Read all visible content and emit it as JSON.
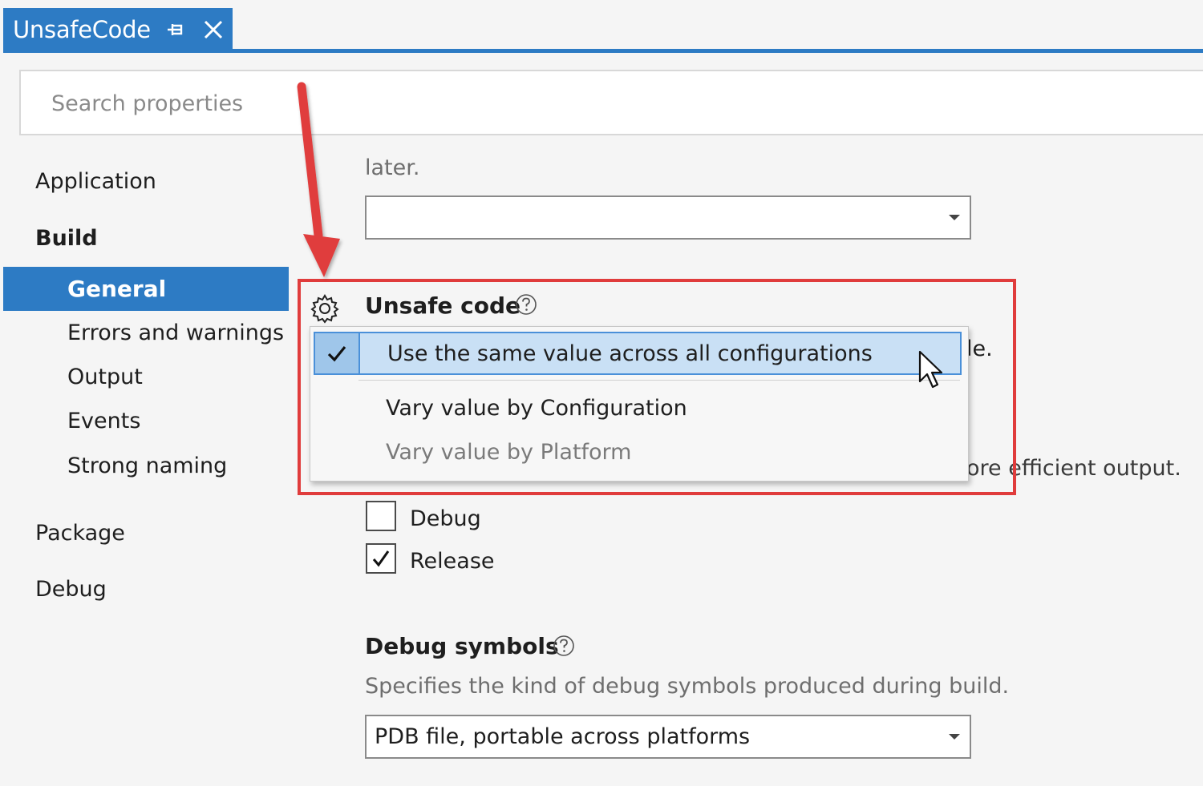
{
  "tab": {
    "title": "UnsafeCode"
  },
  "search": {
    "placeholder": "Search properties"
  },
  "sidebar": {
    "items": [
      {
        "label": "Application"
      },
      {
        "label": "Build"
      },
      {
        "label": "General"
      },
      {
        "label": "Errors and warnings"
      },
      {
        "label": "Output"
      },
      {
        "label": "Events"
      },
      {
        "label": "Strong naming"
      },
      {
        "label": "Package"
      },
      {
        "label": "Debug"
      }
    ]
  },
  "main": {
    "partial_top_text": "later.",
    "top_combo_value": "",
    "unsafe_code": {
      "heading": "Unsafe code",
      "partial_right_text": "le."
    },
    "optimize": {
      "partial_text": "ore efficient output.",
      "options": [
        {
          "label": "Debug",
          "checked": false
        },
        {
          "label": "Release",
          "checked": true
        }
      ]
    },
    "debug_symbols": {
      "heading": "Debug symbols",
      "description": "Specifies the kind of debug symbols produced during build.",
      "value": "PDB file, portable across platforms"
    }
  },
  "dropdown": {
    "items": [
      {
        "label": "Use the same value across all configurations",
        "checked": true
      },
      {
        "label": "Vary value by Configuration"
      },
      {
        "label": "Vary value by Platform",
        "disabled": true
      }
    ]
  },
  "colors": {
    "accent": "#2d7bc4",
    "highlight_red": "#e03c3c",
    "selected_row": "#c9e0f5"
  }
}
